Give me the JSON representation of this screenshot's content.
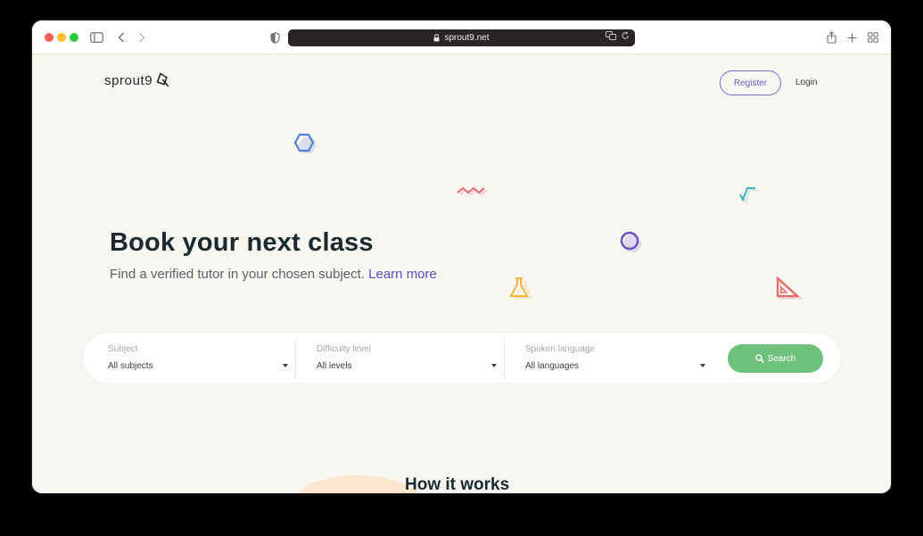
{
  "browser": {
    "url": "sprout9.net"
  },
  "header": {
    "logo_text": "sprout9",
    "register_label": "Register",
    "login_label": "Login"
  },
  "hero": {
    "title": "Book your next class",
    "subtitle": "Find a verified tutor in your chosen subject.",
    "learn_more": "Learn more"
  },
  "search": {
    "subject_label": "Subject",
    "subject_value": "All subjects",
    "difficulty_label": "Difficulty level",
    "difficulty_value": "All levels",
    "language_label": "Spoken language",
    "language_value": "All languages",
    "button_label": "Search"
  },
  "section": {
    "how_it_works": "How it works"
  },
  "colors": {
    "accent_purple": "#6a5cc4",
    "search_green": "#6fc17e",
    "background": "#f8f6f1"
  },
  "icons": [
    "sidebar-icon",
    "back-icon",
    "forward-icon",
    "shield-icon",
    "lock-icon",
    "translate-icon",
    "reload-icon",
    "share-icon",
    "new-tab-icon",
    "tab-overview-icon",
    "search-icon",
    "hexagon-icon",
    "zigzag-icon",
    "sqrt-icon",
    "circle-icon",
    "flask-icon",
    "set-square-icon"
  ]
}
